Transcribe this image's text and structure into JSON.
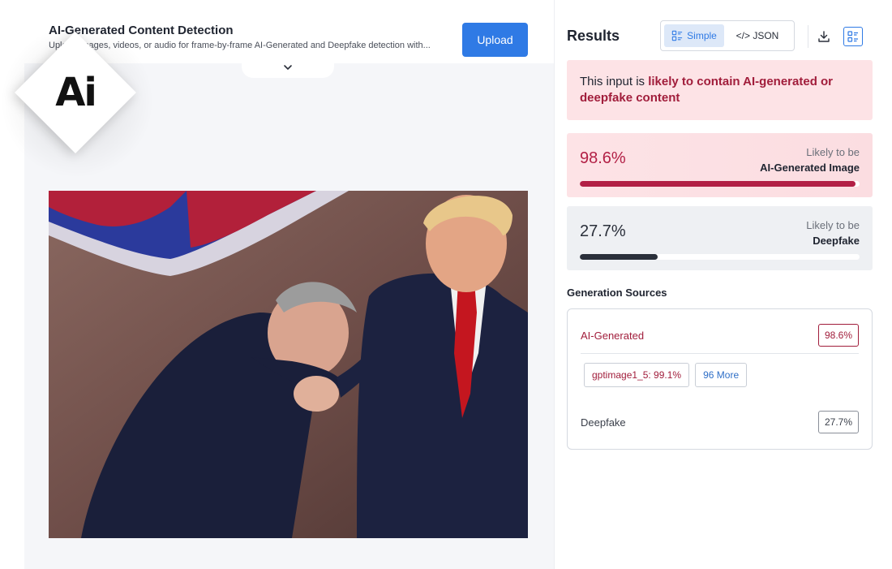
{
  "header": {
    "title": "AI-Generated Content Detection",
    "subtitle": "Upload images, videos, or audio for frame-by-frame AI-Generated and Deepfake detection with...",
    "upload_label": "Upload"
  },
  "logo": {
    "text": "Ai"
  },
  "results": {
    "title": "Results",
    "view_options": {
      "simple": "Simple",
      "json": "</> JSON"
    },
    "verdict": {
      "prefix": "This input is ",
      "emphasis": "likely to contain AI-generated or deepfake content"
    },
    "scores": [
      {
        "value": "98.6%",
        "fraction": 0.986,
        "label_top": "Likely to be",
        "label_bottom": "AI-Generated Image"
      },
      {
        "value": "27.7%",
        "fraction": 0.277,
        "label_top": "Likely to be",
        "label_bottom": "Deepfake"
      }
    ],
    "sources": {
      "title": "Generation Sources",
      "ai": {
        "name": "AI-Generated",
        "pct": "98.6%"
      },
      "model_chip": "gptimage1_5: 99.1%",
      "more_chip": "96 More",
      "deepfake": {
        "name": "Deepfake",
        "pct": "27.7%"
      }
    }
  },
  "colors": {
    "accent": "#2f7ae5",
    "ai_red": "#b21f45",
    "verdict_bg": "#fde3e6"
  },
  "icons": [
    "chevron-down-icon",
    "simple-view-icon",
    "download-icon",
    "details-icon"
  ]
}
